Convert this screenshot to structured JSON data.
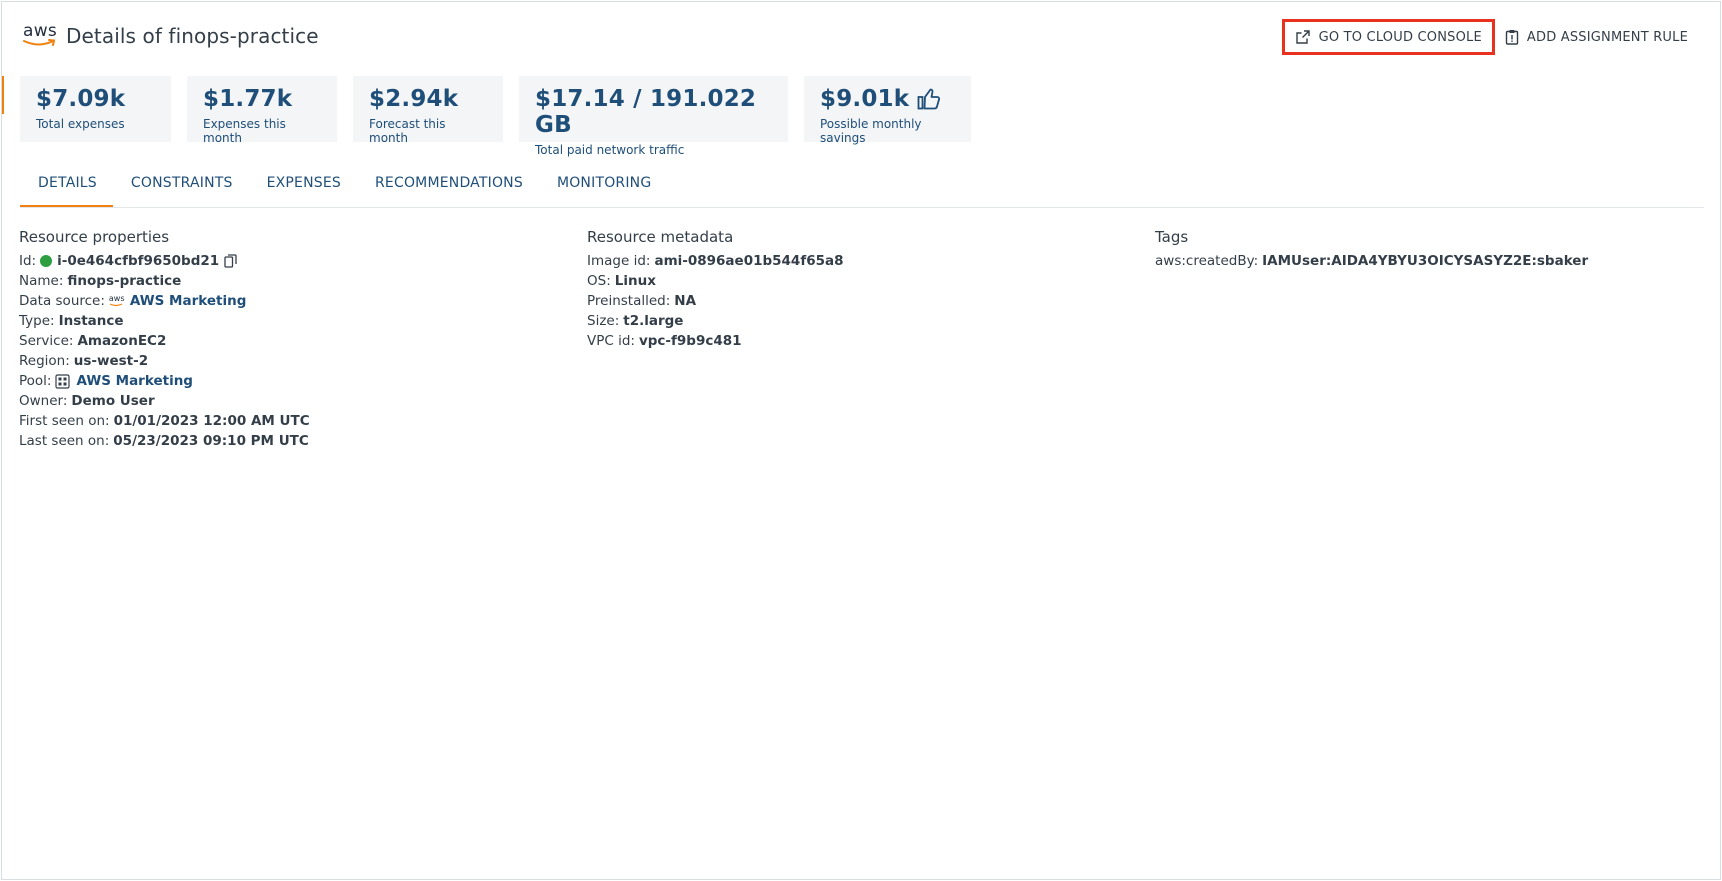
{
  "header": {
    "logo_text": "aws",
    "title": "Details of finops-practice"
  },
  "actions": {
    "cloud_console_label": "GO TO CLOUD CONSOLE",
    "assignment_rule_label": "ADD ASSIGNMENT RULE"
  },
  "stats": [
    {
      "value": "$7.09k",
      "label": "Total expenses"
    },
    {
      "value": "$1.77k",
      "label": "Expenses this month"
    },
    {
      "value": "$2.94k",
      "label": "Forecast this month"
    },
    {
      "value": "$17.14 / 191.022 GB",
      "label": "Total paid network traffic"
    },
    {
      "value": "$9.01k",
      "label": "Possible monthly savings",
      "icon": "thumbs-up-icon"
    }
  ],
  "tabs": [
    {
      "label": "DETAILS",
      "active": true
    },
    {
      "label": "CONSTRAINTS"
    },
    {
      "label": "EXPENSES"
    },
    {
      "label": "RECOMMENDATIONS"
    },
    {
      "label": "MONITORING"
    }
  ],
  "properties": {
    "title": "Resource properties",
    "id_key": "Id:",
    "id_value": "i-0e464cfbf9650bd21",
    "name_key": "Name:",
    "name_value": "finops-practice",
    "datasource_key": "Data source:",
    "datasource_logo": "aws",
    "datasource_value": "AWS Marketing",
    "type_key": "Type:",
    "type_value": "Instance",
    "service_key": "Service:",
    "service_value": "AmazonEC2",
    "region_key": "Region:",
    "region_value": "us-west-2",
    "pool_key": "Pool:",
    "pool_value": "AWS Marketing",
    "owner_key": "Owner:",
    "owner_value": "Demo User",
    "first_seen_key": "First seen on:",
    "first_seen_value": "01/01/2023 12:00 AM UTC",
    "last_seen_key": "Last seen on:",
    "last_seen_value": "05/23/2023 09:10 PM UTC"
  },
  "metadata": {
    "title": "Resource metadata",
    "image_key": "Image id:",
    "image_value": "ami-0896ae01b544f65a8",
    "os_key": "OS:",
    "os_value": "Linux",
    "preinstalled_key": "Preinstalled:",
    "preinstalled_value": "NA",
    "size_key": "Size:",
    "size_value": "t2.large",
    "vpc_key": "VPC id:",
    "vpc_value": "vpc-f9b9c481"
  },
  "tags": {
    "title": "Tags",
    "tag_key": "aws:createdBy:",
    "tag_value": "IAMUser:AIDA4YBYU3OICYSASYZ2E:sbaker"
  },
  "colors": {
    "accent": "#f0810f",
    "link": "#1f4e79",
    "highlight": "#e8311e",
    "status_ok": "#2e9e41"
  }
}
